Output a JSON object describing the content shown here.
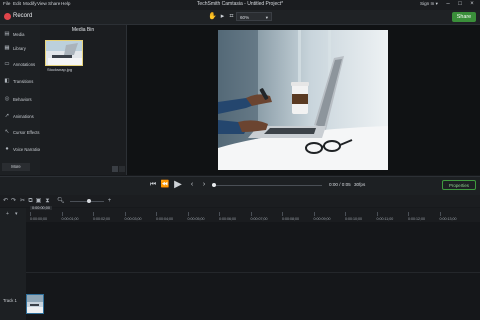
{
  "menu": [
    "File",
    "Edit",
    "Modify",
    "View",
    "Share",
    "Help"
  ],
  "window": {
    "title": "TechSmith Camtasia - Untitled Project*",
    "sign_in": "Sign In ▾"
  },
  "toolbar": {
    "record_label": "Record",
    "zoom_value": "60%",
    "share_label": "Share"
  },
  "sidebar": {
    "items": [
      {
        "label": "Media",
        "icon": "media-icon"
      },
      {
        "label": "Library",
        "icon": "library-icon"
      },
      {
        "label": "Annotations",
        "icon": "annotations-icon"
      },
      {
        "label": "Transitions",
        "icon": "transitions-icon"
      },
      {
        "label": "Behaviors",
        "icon": "behaviors-icon"
      },
      {
        "label": "Animations",
        "icon": "animations-icon"
      },
      {
        "label": "Cursor Effects",
        "icon": "cursor-icon"
      },
      {
        "label": "Voice Narration",
        "icon": "microphone-icon"
      }
    ],
    "more_label": "More"
  },
  "media_bin": {
    "title": "Media Bin",
    "item_name": "Stocksnap.jpg"
  },
  "playback": {
    "timecode": "0:00 / 0:05",
    "fps": "30fps",
    "properties_label": "Properties"
  },
  "timeline": {
    "playhead": "0:00:00;00",
    "ticks": [
      "0:00:00;00",
      "0:00:01;00",
      "0:00:02;00",
      "0:00:03;00",
      "0:00:04;00",
      "0:00:05;00",
      "0:00:06;00",
      "0:00:07;00",
      "0:00:08;00",
      "0:00:09;00",
      "0:00:10;00",
      "0:00:11;00",
      "0:00:12;00",
      "0:00:13;00"
    ],
    "track_label": "Track 1"
  },
  "colors": {
    "accent_green": "#3a8f3a",
    "record_red": "#e0454b",
    "clip_border": "#2f6f9a"
  }
}
